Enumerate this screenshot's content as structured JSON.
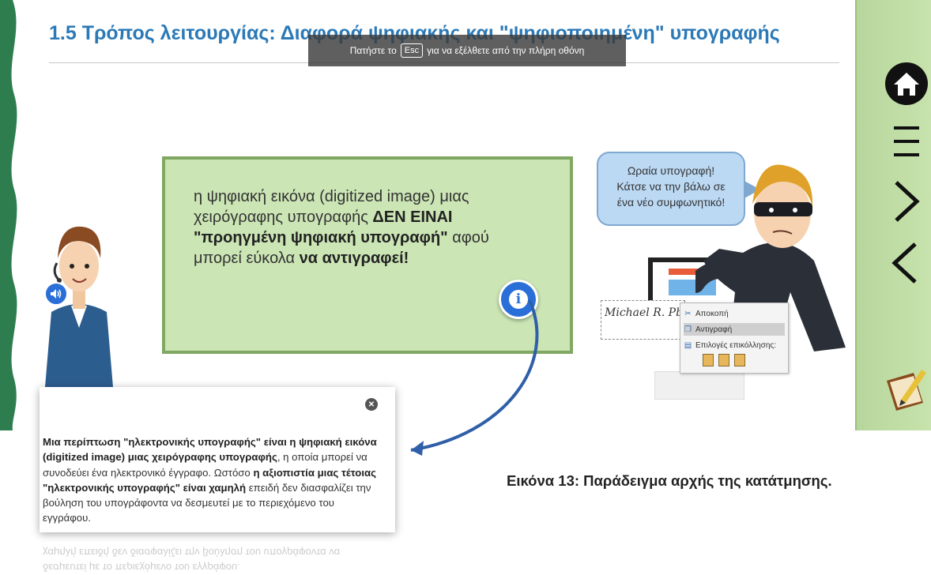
{
  "slide": {
    "title": "1.5 Τρόπος λειτουργίας: Διαφορά ψηφιακής και \"ψηφιοποιημένη\" υπογραφής"
  },
  "fullscreen_notice": {
    "before": "Πατήστε το",
    "key": "Esc",
    "after": "για να εξέλθετε από την πλήρη οθόνη"
  },
  "main_box": {
    "part1": "η ψηφιακή εικόνα (digitized image) μιας χειρόγραφης υπογραφής ",
    "bold1": "ΔΕΝ ΕΙΝΑΙ \"προηγμένη ψηφιακή υπογραφή\"",
    "part2": " αφού μπορεί εύκολα ",
    "bold2": "να αντιγραφεί!"
  },
  "bubble": {
    "line1": "Ωραία υπογραφή!",
    "line2": "Κάτσε να την βάλω σε",
    "line3": "ένα νέο συμφωνητικό!"
  },
  "context_menu": {
    "cut": "Αποκοπή",
    "copy": "Αντιγραφή",
    "paste_options": "Επιλογές επικόλλησης:"
  },
  "signature_text": "Michael R. Pbrouhi",
  "popup": {
    "bold1": "Μια περίπτωση \"ηλεκτρονικής υπογραφής\" είναι η ψηφιακή εικόνα (digitized image) μιας χειρόγραφης υπογραφής",
    "part1": ", η οποία μπορεί να συνοδεύει ένα ηλεκτρονικό έγγραφο. Ωστόσο ",
    "bold2": "η αξιοπιστία μιας τέτοιας \"ηλεκτρονικής υπογραφής\" είναι χαμηλή",
    "part2": " επειδή δεν διασφαλίζει την βούληση του υπογράφοντα να δεσμευτεί με το περιεχόμενο του εγγράφου.",
    "reflection1": "δεσμευτεί με το περιεχόμενο του εγγράφου.",
    "reflection2": "χαμηλή επειδή δεν διασφαλίζει την βούληση του υπογράφοντα να"
  },
  "caption": "Εικόνα 13: Παράδειγμα αρχής της κατάτμησης.",
  "icons": {
    "home": "home-icon",
    "menu": "hamburger-menu-icon",
    "next": "chevron-right-icon",
    "prev": "chevron-left-icon",
    "notes": "notebook-pencil-icon",
    "info": "info-icon",
    "sound": "speaker-icon",
    "close": "close-icon"
  },
  "colors": {
    "title": "#2b79b7",
    "green_box_fill": "#cbe5b5",
    "green_box_border": "#80a863",
    "accent_blue": "#2a6fd8",
    "sidebar_green": "#c8e3ad",
    "wavy_green": "#2e7d4f"
  }
}
